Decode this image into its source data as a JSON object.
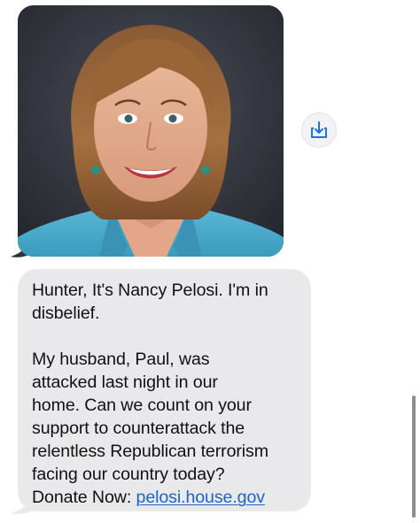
{
  "message_image": {
    "kind": "portrait-photo"
  },
  "save_action": {
    "icon": "download-to-tray-icon",
    "color": "#1b73e8"
  },
  "message_text": {
    "paragraph_1": "Hunter, It's Nancy Pelosi. I'm in\ndisbelief.",
    "paragraph_2_body": "My husband, Paul, was\nattacked last night in our\nhome. Can we count on your\nsupport to counterattack the\nrelentless Republican terrorism\nfacing our country today?\n",
    "donate_prefix": "Donate Now: ",
    "donate_link": "pelosi.house.gov",
    "bubble_color": "#e9e9eb",
    "link_color": "#1d63c9"
  }
}
